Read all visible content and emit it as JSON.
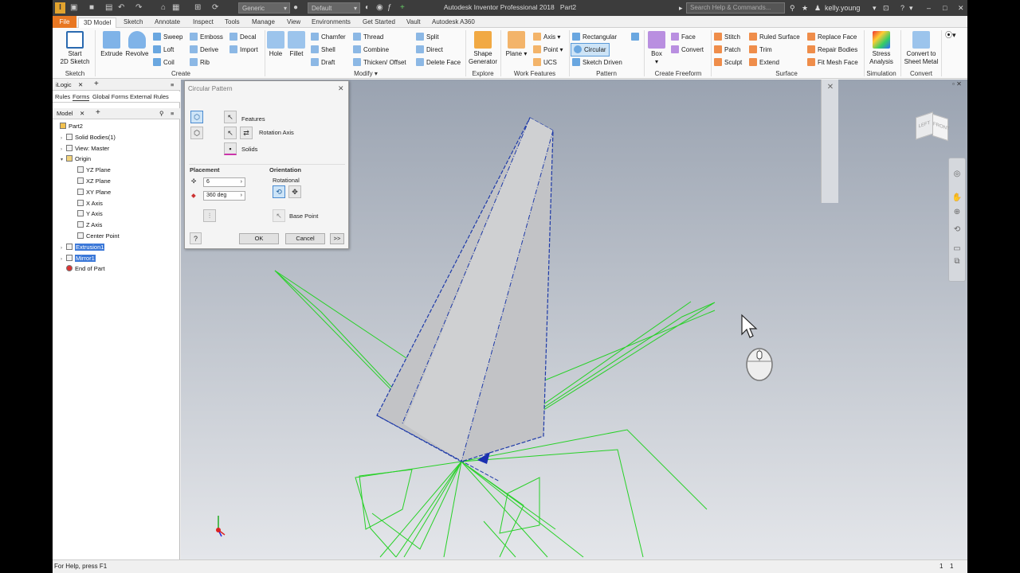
{
  "titlebar": {
    "app_title": "Autodesk Inventor Professional 2018",
    "doc_name": "Part2",
    "appearance": "Generic",
    "material": "Default",
    "search_placeholder": "Search Help & Commands...",
    "user": "kelly.young"
  },
  "tabs": [
    "File",
    "3D Model",
    "Sketch",
    "Annotate",
    "Inspect",
    "Tools",
    "Manage",
    "View",
    "Environments",
    "Get Started",
    "Vault",
    "Autodesk A360"
  ],
  "ribbon": {
    "sketch": {
      "start_sketch": "Start",
      "start_sketch2": "2D Sketch",
      "panel": "Sketch"
    },
    "create": {
      "extrude": "Extrude",
      "revolve": "Revolve",
      "sweep": "Sweep",
      "emboss": "Emboss",
      "decal": "Decal",
      "loft": "Loft",
      "derive": "Derive",
      "import": "Import",
      "coil": "Coil",
      "rib": "Rib",
      "panel": "Create"
    },
    "modify": {
      "hole": "Hole",
      "fillet": "Fillet",
      "chamfer": "Chamfer",
      "thread": "Thread",
      "split": "Split",
      "shell": "Shell",
      "combine": "Combine",
      "direct": "Direct",
      "draft": "Draft",
      "thicken": "Thicken/ Offset",
      "delete_face": "Delete Face",
      "panel": "Modify"
    },
    "explore": {
      "shape_gen1": "Shape",
      "shape_gen2": "Generator",
      "panel": "Explore"
    },
    "work": {
      "plane": "Plane",
      "axis": "Axis",
      "point": "Point",
      "ucs": "UCS",
      "panel": "Work Features"
    },
    "pattern": {
      "rectangular": "Rectangular",
      "circular": "Circular",
      "sketch_driven": "Sketch Driven",
      "panel": "Pattern"
    },
    "freeform": {
      "box": "Box",
      "face": "Face",
      "convert": "Convert",
      "panel": "Create Freeform"
    },
    "surface": {
      "stitch": "Stitch",
      "ruled": "Ruled Surface",
      "replace": "Replace Face",
      "patch": "Patch",
      "trim": "Trim",
      "repair": "Repair Bodies",
      "sculpt": "Sculpt",
      "extend": "Extend",
      "fit_mesh": "Fit Mesh Face",
      "panel": "Surface"
    },
    "simulation": {
      "stress1": "Stress",
      "stress2": "Analysis",
      "panel": "Simulation"
    },
    "convert": {
      "sheet1": "Convert to",
      "sheet2": "Sheet Metal",
      "panel": "Convert"
    }
  },
  "browser": {
    "ilogic_tab": "iLogic",
    "subtabs": [
      "Rules",
      "Forms",
      "Global Forms",
      "External Rules"
    ],
    "model_tab": "Model",
    "tree": [
      {
        "label": "Part2",
        "indent": 0
      },
      {
        "label": "Solid Bodies(1)",
        "indent": 1
      },
      {
        "label": "View: Master",
        "indent": 1
      },
      {
        "label": "Origin",
        "indent": 1
      },
      {
        "label": "YZ Plane",
        "indent": 2
      },
      {
        "label": "XZ Plane",
        "indent": 2
      },
      {
        "label": "XY Plane",
        "indent": 2
      },
      {
        "label": "X Axis",
        "indent": 2
      },
      {
        "label": "Y Axis",
        "indent": 2
      },
      {
        "label": "Z Axis",
        "indent": 2
      },
      {
        "label": "Center Point",
        "indent": 2
      },
      {
        "label": "Extrusion1",
        "indent": 1,
        "selected": true
      },
      {
        "label": "Mirror1",
        "indent": 1,
        "selected": true
      },
      {
        "label": "End of Part",
        "indent": 1
      }
    ]
  },
  "dialog": {
    "title": "Circular Pattern",
    "features": "Features",
    "rotation_axis": "Rotation Axis",
    "solids": "Solids",
    "placement": "Placement",
    "count": "6",
    "angle": "360 deg",
    "orientation": "Orientation",
    "rotational": "Rotational",
    "base_point": "Base Point",
    "ok": "OK",
    "cancel": "Cancel",
    "more": ">>"
  },
  "viewcube": {
    "left": "LEFT",
    "front": "FRONT"
  },
  "status": {
    "help": "For Help, press F1",
    "count1": "1",
    "count2": "1"
  },
  "colors": {
    "accent": "#e87722",
    "selection": "#3b78d8",
    "wire": "#22cc22",
    "edge": "#1e3aa8"
  }
}
